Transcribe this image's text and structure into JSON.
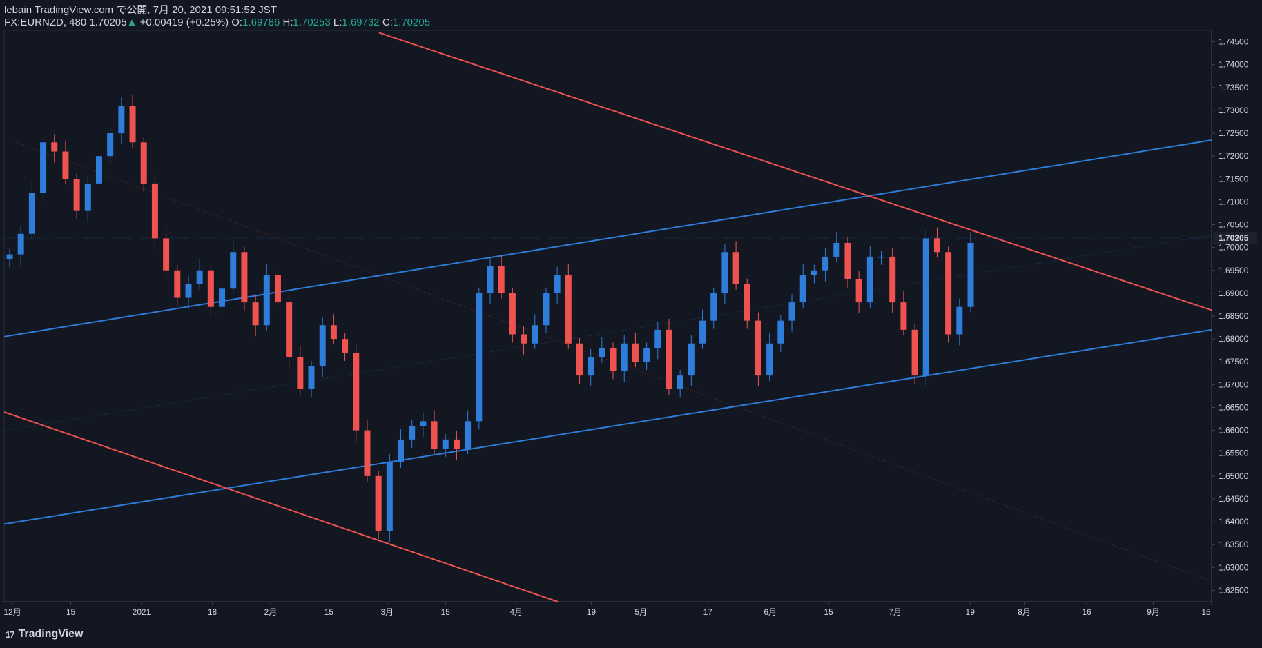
{
  "header": {
    "publisher": "lebain TradingView.com で公開, 7月 20, 2021 09:51:52 JST",
    "symbol": "FX:EURNZD, 480",
    "last": "1.70205",
    "change_arrow": "▲",
    "change": "+0.00419 (+0.25%)",
    "o_label": "O:",
    "o_value": "1.69786",
    "h_label": "H:",
    "h_value": "1.70253",
    "l_label": "L:",
    "l_value": "1.69732",
    "c_label": "C:",
    "c_value": "1.70205"
  },
  "footer": {
    "logo_mark": "17",
    "logo_text": "TradingView"
  },
  "colors": {
    "background": "#131722",
    "up": "#2f7ddb",
    "down": "#ef5350",
    "channel_blue": "#2f7ddb",
    "channel_red": "#ef5350",
    "axis_text": "#d1d4dc",
    "price_badge_bg": "#1e222d"
  },
  "chart_data": {
    "type": "candlestick",
    "ylim": [
      1.6225,
      1.7475
    ],
    "y_ticks": [
      "1.74500",
      "1.74000",
      "1.73500",
      "1.73000",
      "1.72500",
      "1.72000",
      "1.71500",
      "1.71000",
      "1.70500",
      "1.70000",
      "1.69500",
      "1.69000",
      "1.68500",
      "1.68000",
      "1.67500",
      "1.67000",
      "1.66500",
      "1.66000",
      "1.65500",
      "1.65000",
      "1.64500",
      "1.64000",
      "1.63500",
      "1.63000",
      "1.62500"
    ],
    "x_ticks": [
      "12月",
      "15",
      "2021",
      "18",
      "2月",
      "15",
      "3月",
      "15",
      "4月",
      "19",
      "5月",
      "17",
      "6月",
      "15",
      "7月",
      "19",
      "8月",
      "16",
      "9月",
      "15"
    ],
    "current_price": "1.70205",
    "series": [
      {
        "name": "close",
        "values": [
          1.6985,
          1.703,
          1.712,
          1.723,
          1.721,
          1.715,
          1.708,
          1.714,
          1.72,
          1.725,
          1.731,
          1.723,
          1.714,
          1.702,
          1.695,
          1.689,
          1.692,
          1.695,
          1.687,
          1.691,
          1.699,
          1.688,
          1.683,
          1.694,
          1.688,
          1.676,
          1.669,
          1.674,
          1.683,
          1.68,
          1.677,
          1.66,
          1.65,
          1.638,
          1.653,
          1.658,
          1.661,
          1.662,
          1.656,
          1.658,
          1.656,
          1.662,
          1.69,
          1.696,
          1.69,
          1.681,
          1.679,
          1.683,
          1.69,
          1.694,
          1.679,
          1.672,
          1.676,
          1.678,
          1.673,
          1.679,
          1.675,
          1.678,
          1.682,
          1.669,
          1.672,
          1.679,
          1.684,
          1.69,
          1.699,
          1.692,
          1.684,
          1.672,
          1.679,
          1.684,
          1.688,
          1.694,
          1.695,
          1.698,
          1.701,
          1.693,
          1.688,
          1.698,
          1.698,
          1.688,
          1.682,
          1.672,
          1.702,
          1.699,
          1.681,
          1.687,
          1.701
        ]
      },
      {
        "name": "open",
        "values": [
          1.6975,
          1.6985,
          1.703,
          1.712,
          1.723,
          1.721,
          1.715,
          1.708,
          1.714,
          1.72,
          1.725,
          1.731,
          1.723,
          1.714,
          1.702,
          1.695,
          1.689,
          1.692,
          1.695,
          1.687,
          1.691,
          1.699,
          1.688,
          1.683,
          1.694,
          1.688,
          1.676,
          1.669,
          1.674,
          1.683,
          1.68,
          1.677,
          1.66,
          1.65,
          1.638,
          1.653,
          1.658,
          1.661,
          1.662,
          1.656,
          1.658,
          1.656,
          1.662,
          1.69,
          1.696,
          1.69,
          1.681,
          1.679,
          1.683,
          1.69,
          1.694,
          1.679,
          1.672,
          1.676,
          1.678,
          1.673,
          1.679,
          1.675,
          1.678,
          1.682,
          1.669,
          1.672,
          1.679,
          1.684,
          1.69,
          1.699,
          1.692,
          1.684,
          1.672,
          1.679,
          1.684,
          1.688,
          1.694,
          1.695,
          1.698,
          1.701,
          1.693,
          1.688,
          1.698,
          1.698,
          1.688,
          1.682,
          1.672,
          1.702,
          1.699,
          1.681,
          1.687
        ]
      }
    ],
    "trendlines": [
      {
        "name": "upper-blue-channel",
        "color": "blue",
        "from": [
          "2020-11-29",
          1.6805
        ],
        "to": [
          "2021-09-15",
          1.7235
        ]
      },
      {
        "name": "lower-blue-channel",
        "color": "blue",
        "from": [
          "2020-11-29",
          1.6395
        ],
        "to": [
          "2021-09-15",
          1.682
        ]
      },
      {
        "name": "upper-red-channel",
        "color": "red",
        "from": [
          "2021-02-27",
          1.747
        ],
        "to": [
          "2021-09-15",
          1.6863
        ]
      },
      {
        "name": "lower-red-channel",
        "color": "red",
        "from": [
          "2020-11-29",
          1.664
        ],
        "to": [
          "2021-04-11",
          1.6225
        ]
      }
    ]
  }
}
